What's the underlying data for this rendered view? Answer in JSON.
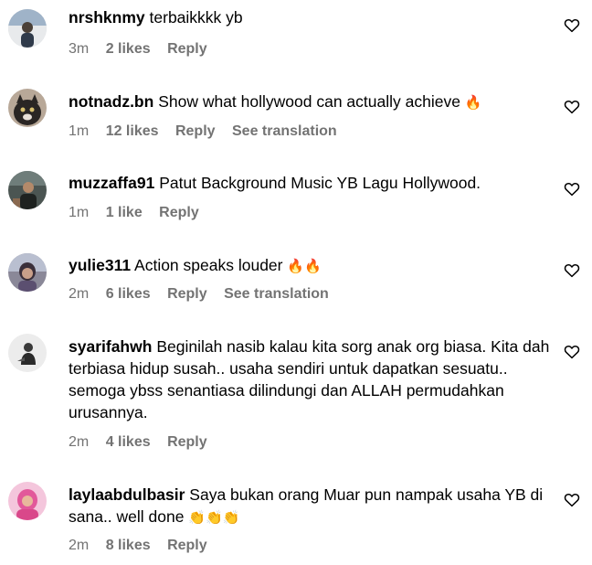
{
  "comments": [
    {
      "username": "nrshknmy",
      "text": "terbaikkkk yb",
      "emoji": "",
      "time": "3m",
      "likes": "2 likes",
      "reply": "Reply",
      "translation": "",
      "avatar_color": "#8a8f96"
    },
    {
      "username": "notnadz.bn",
      "text": "Show what hollywood can actually achieve",
      "emoji": "🔥",
      "time": "1m",
      "likes": "12 likes",
      "reply": "Reply",
      "translation": "See translation",
      "avatar_color": "#5a5048"
    },
    {
      "username": "muzzaffa91",
      "text": "Patut Background Music YB Lagu Hollywood.",
      "emoji": "",
      "time": "1m",
      "likes": "1 like",
      "reply": "Reply",
      "translation": "",
      "avatar_color": "#3f4642"
    },
    {
      "username": "yulie311",
      "text": "Action speaks louder",
      "emoji": "🔥🔥",
      "time": "2m",
      "likes": "6 likes",
      "reply": "Reply",
      "translation": "See translation",
      "avatar_color": "#6d6a7a"
    },
    {
      "username": "syarifahwh",
      "text": "Beginilah nasib kalau kita sorg anak org biasa. Kita dah terbiasa hidup susah.. usaha sendiri untuk dapatkan sesuatu.. semoga ybss senantiasa dilindungi dan ALLAH permudahkan urusannya.",
      "emoji": "",
      "time": "2m",
      "likes": "4 likes",
      "reply": "Reply",
      "translation": "",
      "avatar_color": "#e6e6e6"
    },
    {
      "username": "laylaabdulbasir",
      "text": "Saya bukan orang Muar pun nampak usaha YB di sana.. well done",
      "emoji": "👏👏👏",
      "time": "2m",
      "likes": "8 likes",
      "reply": "Reply",
      "translation": "",
      "avatar_color": "#e889b8"
    }
  ],
  "colors": {
    "text": "#000000",
    "meta": "#737373",
    "background": "#ffffff"
  },
  "icons": {
    "like": "heart-outline-icon"
  }
}
